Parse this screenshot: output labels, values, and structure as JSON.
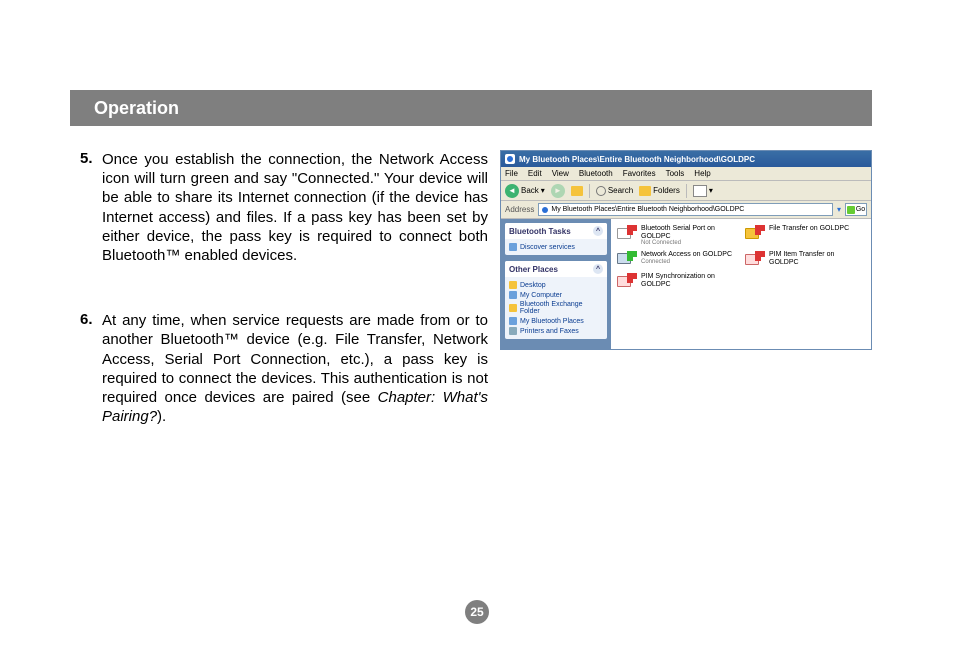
{
  "header": {
    "title": "Operation"
  },
  "steps": {
    "s5_num": "5.",
    "s5_text": "Once you establish the connection, the Network Access icon will turn green and say \"Connected.\" Your device will be able to share its Internet connection (if the device has Internet access) and files. If a pass key has been set by either device, the pass key is required to connect both Bluetooth™ enabled devices.",
    "s6_num": "6.",
    "s6_text_a": "At any time, when service requests are made from or to another Bluetooth™ device (e.g. File Transfer, Network Access, Serial Port Connection, etc.), a pass key is required to connect the devices. This authentication is not required once devices are paired (see ",
    "s6_text_italic": "Chapter: What's Pairing?",
    "s6_text_b": ")."
  },
  "screenshot": {
    "titlebar": "My Bluetooth Places\\Entire Bluetooth Neighborhood\\GOLDPC",
    "menus": {
      "file": "File",
      "edit": "Edit",
      "view": "View",
      "bluetooth": "Bluetooth",
      "favorites": "Favorites",
      "tools": "Tools",
      "help": "Help"
    },
    "toolbar": {
      "back": "Back",
      "search": "Search",
      "folders": "Folders"
    },
    "address": {
      "label": "Address",
      "value": "My Bluetooth Places\\Entire Bluetooth Neighborhood\\GOLDPC",
      "go": "Go"
    },
    "sidebar": {
      "tasks_hdr": "Bluetooth Tasks",
      "tasks": {
        "discover": "Discover services"
      },
      "other_hdr": "Other Places",
      "other": {
        "desktop": "Desktop",
        "mycomputer": "My Computer",
        "exchange": "Bluetooth Exchange Folder",
        "mybt": "My Bluetooth Places",
        "printers": "Printers and Faxes"
      }
    },
    "services": {
      "serial": {
        "name": "Bluetooth Serial Port on GOLDPC",
        "status": "Not Connected"
      },
      "file": {
        "name": "File Transfer on GOLDPC",
        "status": ""
      },
      "network": {
        "name": "Network Access on GOLDPC",
        "status": "Connected"
      },
      "pimitem": {
        "name": "PIM Item Transfer on GOLDPC",
        "status": ""
      },
      "pimsync": {
        "name": "PIM Synchronization on GOLDPC",
        "status": ""
      }
    }
  },
  "page_number": "25"
}
